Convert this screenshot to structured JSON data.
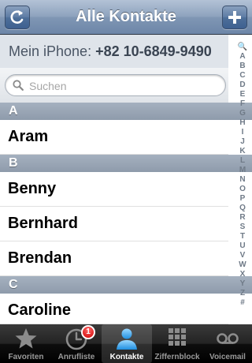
{
  "header": {
    "title": "Alle Kontakte",
    "left_icon": "refresh-icon",
    "right_icon": "plus-icon"
  },
  "my_number": {
    "label": "Mein iPhone:",
    "number": "+82 10-6849-9490"
  },
  "search": {
    "placeholder": "Suchen"
  },
  "sections": [
    {
      "letter": "A",
      "contacts": [
        "Aram"
      ]
    },
    {
      "letter": "B",
      "contacts": [
        "Benny",
        "Bernhard",
        "Brendan"
      ]
    },
    {
      "letter": "C",
      "contacts": [
        "Caroline"
      ]
    }
  ],
  "index": [
    "🔍",
    "A",
    "B",
    "C",
    "D",
    "E",
    "F",
    "G",
    "H",
    "I",
    "J",
    "K",
    "L",
    "M",
    "N",
    "O",
    "P",
    "Q",
    "R",
    "S",
    "T",
    "U",
    "V",
    "W",
    "X",
    "Y",
    "Z",
    "#"
  ],
  "tabs": [
    {
      "label": "Favoriten",
      "icon": "star-icon",
      "active": false
    },
    {
      "label": "Anrufliste",
      "icon": "clock-icon",
      "active": false,
      "badge": "1"
    },
    {
      "label": "Kontakte",
      "icon": "person-icon",
      "active": true
    },
    {
      "label": "Ziffernblock",
      "icon": "keypad-icon",
      "active": false
    },
    {
      "label": "Voicemail",
      "icon": "voicemail-icon",
      "active": false
    }
  ],
  "colors": {
    "navbar": "#7f96b4",
    "section_header": "#98a4b3",
    "badge": "#d00000"
  }
}
